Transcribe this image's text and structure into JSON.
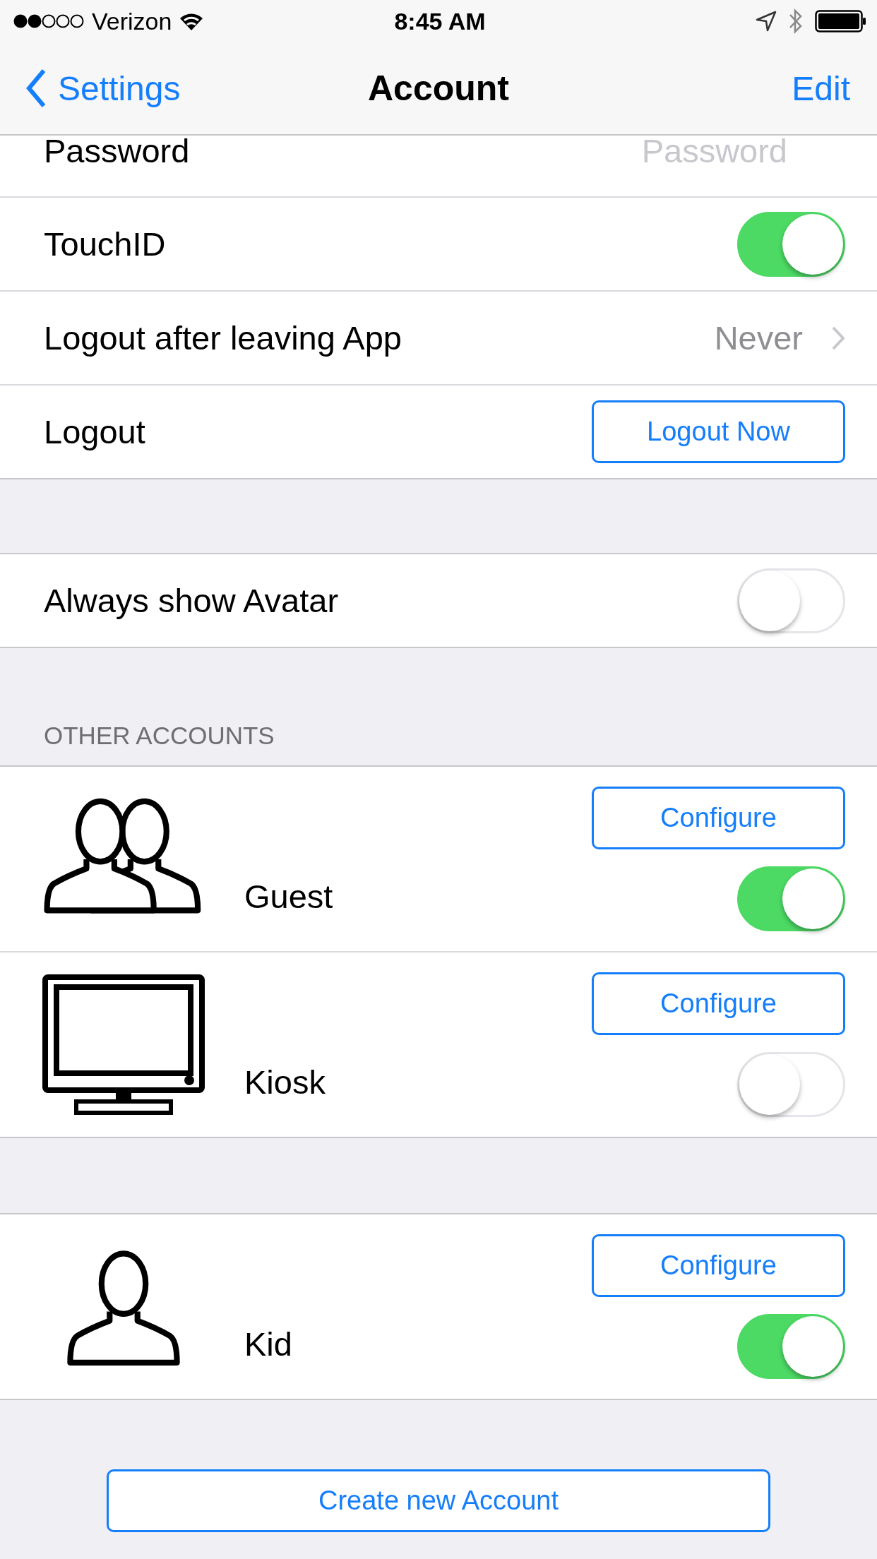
{
  "status_bar": {
    "carrier": "Verizon",
    "time": "8:45 AM"
  },
  "nav": {
    "back": "Settings",
    "title": "Account",
    "action": "Edit"
  },
  "account_settings": [
    {
      "kind": "field",
      "label": "Password",
      "placeholder": "Password"
    },
    {
      "kind": "toggle",
      "label": "TouchID",
      "on": true
    },
    {
      "kind": "disclosure",
      "label": "Logout after leaving App",
      "value": "Never"
    },
    {
      "kind": "button",
      "label": "Logout",
      "button": "Logout Now"
    }
  ],
  "avatar_setting": {
    "label": "Always show Avatar",
    "on": false
  },
  "other_accounts": {
    "header": "OTHER ACCOUNTS",
    "groups": [
      [
        {
          "kind": "group",
          "name": "Guest",
          "button": "Configure",
          "on": true
        },
        {
          "kind": "kiosk",
          "name": "Kiosk",
          "button": "Configure",
          "on": false
        }
      ],
      [
        {
          "kind": "single",
          "name": "Kid",
          "button": "Configure",
          "on": true
        }
      ]
    ]
  },
  "create_button": "Create new Account"
}
